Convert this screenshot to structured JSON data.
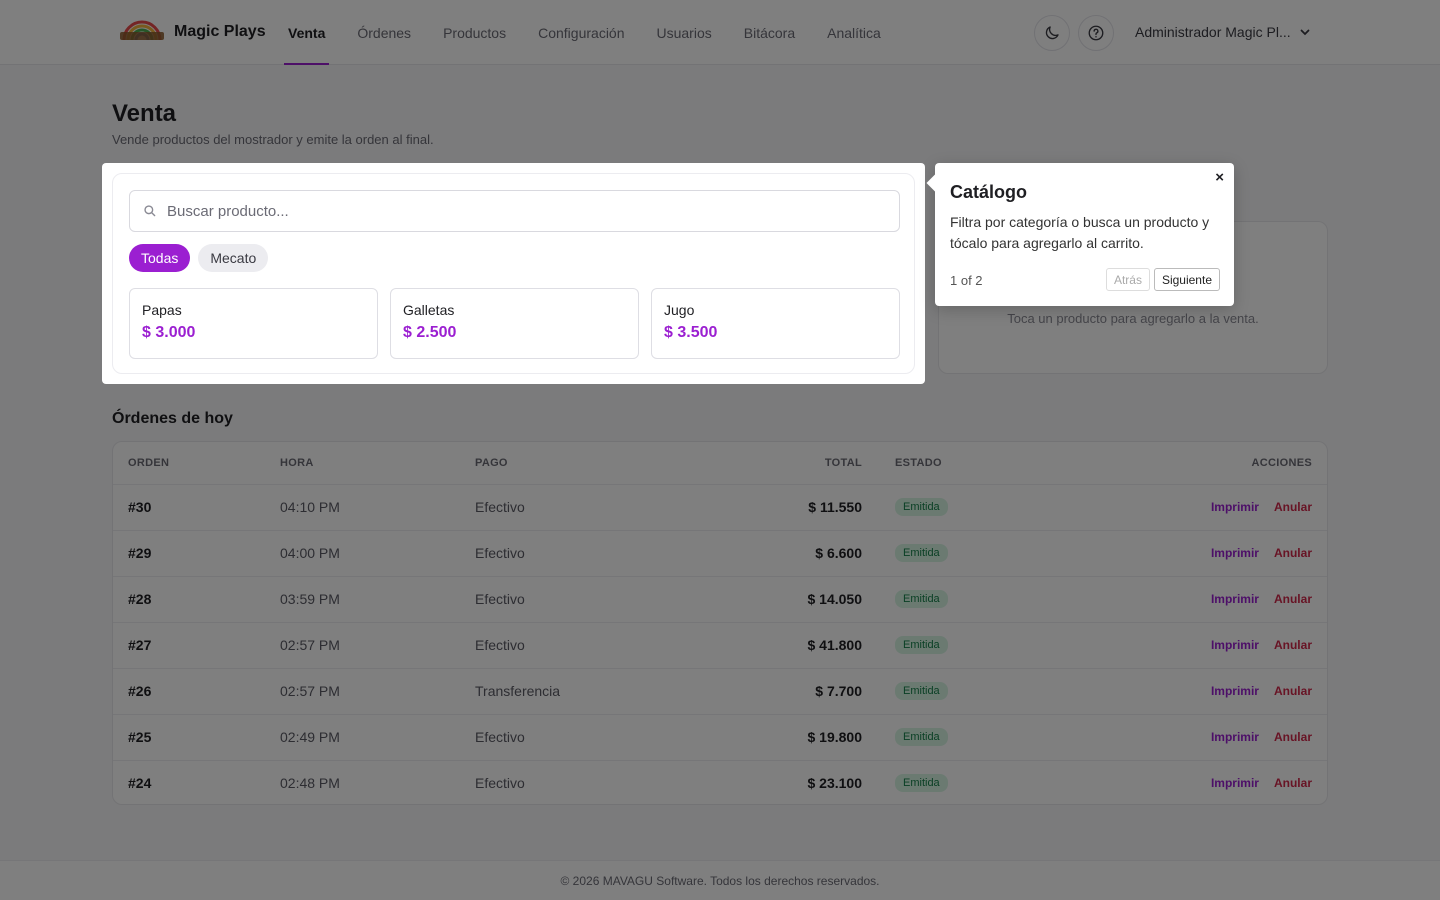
{
  "header": {
    "brand": "Magic Plays",
    "nav": [
      "Venta",
      "Órdenes",
      "Productos",
      "Configuración",
      "Usuarios",
      "Bitácora",
      "Analítica"
    ],
    "active_nav": "Venta",
    "theme_icon": "moon-icon",
    "help_icon": "question-circle-icon",
    "user": "Administrador Magic Pl..."
  },
  "page": {
    "title": "Venta",
    "subtitle": "Vende productos del mostrador y emite la orden al final."
  },
  "catalog": {
    "search_placeholder": "Buscar producto...",
    "categories": [
      "Todas",
      "Mecato"
    ],
    "selected_category": "Todas",
    "products": [
      {
        "name": "Papas",
        "price": "$ 3.000"
      },
      {
        "name": "Galletas",
        "price": "$ 2.500"
      },
      {
        "name": "Jugo",
        "price": "$ 3.500"
      }
    ]
  },
  "cart": {
    "empty_text": "Toca un producto para agregarlo a la venta."
  },
  "orders": {
    "title": "Órdenes de hoy",
    "columns": [
      "ORDEN",
      "HORA",
      "PAGO",
      "TOTAL",
      "ESTADO",
      "ACCIONES"
    ],
    "rows": [
      {
        "id": "#30",
        "time": "04:10 PM",
        "payment": "Efectivo",
        "total": "$ 11.550",
        "status": "Emitida"
      },
      {
        "id": "#29",
        "time": "04:00 PM",
        "payment": "Efectivo",
        "total": "$ 6.600",
        "status": "Emitida"
      },
      {
        "id": "#28",
        "time": "03:59 PM",
        "payment": "Efectivo",
        "total": "$ 14.050",
        "status": "Emitida"
      },
      {
        "id": "#27",
        "time": "02:57 PM",
        "payment": "Efectivo",
        "total": "$ 41.800",
        "status": "Emitida"
      },
      {
        "id": "#26",
        "time": "02:57 PM",
        "payment": "Transferencia",
        "total": "$ 7.700",
        "status": "Emitida"
      },
      {
        "id": "#25",
        "time": "02:49 PM",
        "payment": "Efectivo",
        "total": "$ 19.800",
        "status": "Emitida"
      },
      {
        "id": "#24",
        "time": "02:48 PM",
        "payment": "Efectivo",
        "total": "$ 23.100",
        "status": "Emitida"
      }
    ],
    "print_label": "Imprimir",
    "void_label": "Anular"
  },
  "footer": {
    "text": "© 2026 MAVAGU Software. Todos los derechos reservados."
  },
  "tour": {
    "title": "Catálogo",
    "description": "Filtra por categoría o busca un producto y tócalo para agregarlo al carrito.",
    "progress": "1 of 2",
    "back_label": "Atrás",
    "next_label": "Siguiente",
    "close_label": "×"
  },
  "colors": {
    "accent": "#9b1fd1",
    "danger": "#d1284b",
    "success_bg": "#d6f5e3",
    "success_text": "#16804a"
  }
}
